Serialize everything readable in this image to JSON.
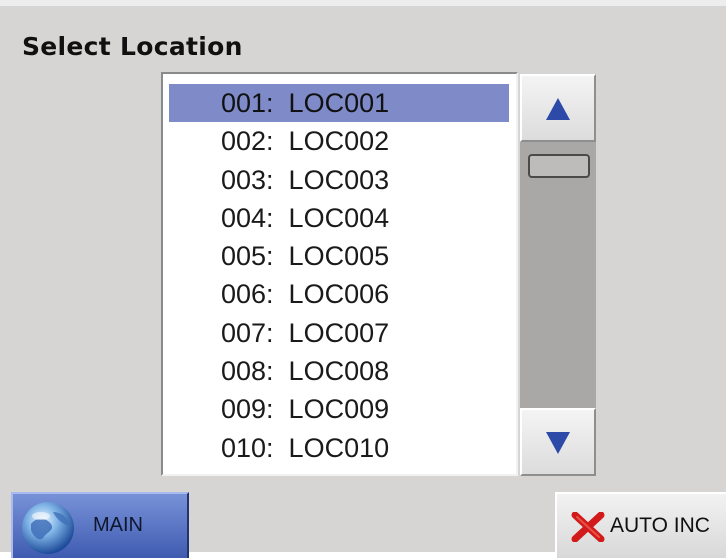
{
  "title": "Select Location",
  "locations": [
    {
      "label": "001:  LOC001",
      "selected": true
    },
    {
      "label": "002:  LOC002",
      "selected": false
    },
    {
      "label": "003:  LOC003",
      "selected": false
    },
    {
      "label": "004:  LOC004",
      "selected": false
    },
    {
      "label": "005:  LOC005",
      "selected": false
    },
    {
      "label": "006:  LOC006",
      "selected": false
    },
    {
      "label": "007:  LOC007",
      "selected": false
    },
    {
      "label": "008:  LOC008",
      "selected": false
    },
    {
      "label": "009:  LOC009",
      "selected": false
    },
    {
      "label": "010:  LOC010",
      "selected": false
    }
  ],
  "scrollbar": {
    "up_icon": "arrow-up-icon",
    "down_icon": "arrow-down-icon",
    "arrow_color": "#2d4aa8"
  },
  "buttons": {
    "main": {
      "label": "MAIN",
      "icon": "globe-icon"
    },
    "auto_inc": {
      "label": "AUTO INC",
      "icon": "red-x-icon"
    }
  },
  "colors": {
    "background": "#d6d5d3",
    "selection": "#7f8bc9",
    "main_button": "#4f6bc2",
    "x_red": "#d21a1a"
  }
}
